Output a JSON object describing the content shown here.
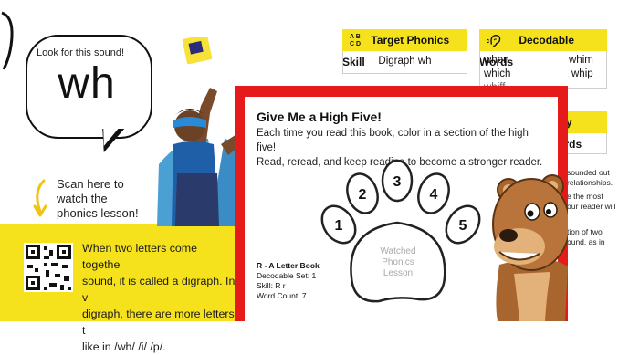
{
  "left_page": {
    "bubble_prompt": "Look for this sound!",
    "sound": "wh",
    "scan_text": "Scan here to watch the phonics lesson!",
    "bottom_text": "When two letters come together to make one sound, it is called a digraph. In when, a digraph, there are more letters than sounds, like in /wh/ /i/ /p/.",
    "bottom_lines": [
      "When two letters come togethe",
      "sound, it is called a digraph. In v",
      "digraph, there are more letters t",
      "like in /wh/ /i/ /p/."
    ],
    "scan_lines": [
      "Scan here to",
      "watch the",
      "phonics lesson!"
    ]
  },
  "right_page": {
    "target_skill": {
      "icon": "ABCD",
      "title": "Target Phonics Skill",
      "value": "Digraph wh"
    },
    "decodable_words": {
      "title": "Decodable Words",
      "words": [
        "when",
        "whim",
        "which",
        "whip",
        "whiff"
      ]
    },
    "high_freq": {
      "title": "y Words"
    },
    "side_note_1": [
      "sounded out",
      "relationships."
    ],
    "side_note_2": [
      "e the most",
      "our reader will"
    ],
    "side_note_3": [
      "tion of two",
      "ound, as in"
    ]
  },
  "card": {
    "title": "Give Me a High Five!",
    "desc_line1": "Each time you read this book, color in a section of the high five!",
    "desc_line2": "Read, reread, and keep reading to become a stronger reader.",
    "toes": [
      "1",
      "2",
      "3",
      "4",
      "5"
    ],
    "pad_text": [
      "Watched",
      "Phonics",
      "Lesson"
    ],
    "book_title": "R - A Letter Book",
    "decodable_set": "Decodable Set: 1",
    "skill": "Skill: R r",
    "word_count": "Word Count: 7"
  },
  "colors": {
    "yellow": "#f6e21c",
    "red": "#e51b1b",
    "bear": "#b8743a"
  },
  "icons": [
    "qr-code-icon",
    "arrow-down-icon",
    "abcd-icon",
    "ear-icon",
    "bear-mascot"
  ]
}
